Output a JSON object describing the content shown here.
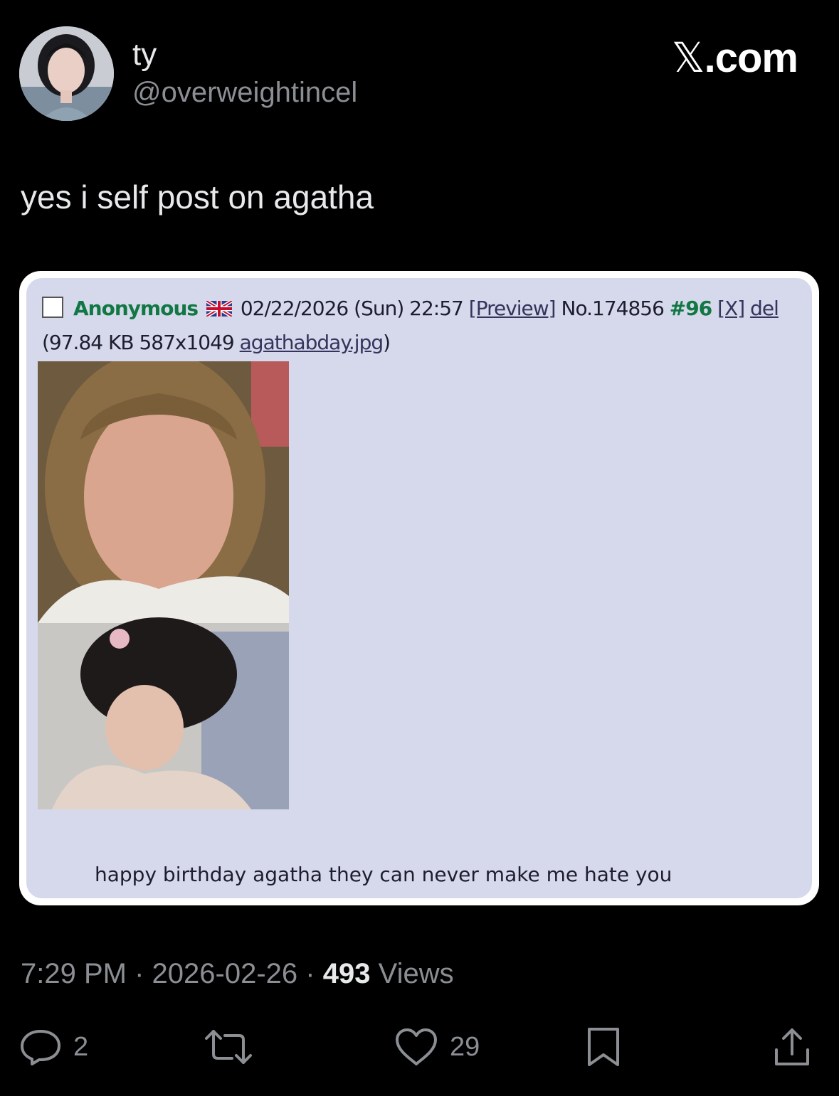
{
  "author": {
    "display_name": "ty",
    "handle": "@overweightincel",
    "avatar_icon": "profile-photo"
  },
  "brand": {
    "x_glyph": "𝕏",
    "suffix": ".com"
  },
  "tweet": {
    "text": "yes i self post on agatha"
  },
  "embedded_post": {
    "name": "Anonymous",
    "flag_icon": "uk-flag-icon",
    "datetime": "02/22/2026 (Sun) 22:57",
    "preview_label": "[Preview]",
    "post_number": "No.174856",
    "reply_ref": "#96",
    "delete_x_label": "[X]",
    "del_label": "del",
    "file_meta": "(97.84 KB 587x1049",
    "file_name": "agathabday.jpg",
    "file_close": ")",
    "comment": "happy birthday agatha they can never make me hate you"
  },
  "meta": {
    "time": "7:29 PM",
    "date": "2026-02-26",
    "views_count": "493",
    "views_label": "Views",
    "separator": "·"
  },
  "actions": {
    "reply_count": "2",
    "like_count": "29",
    "icons": [
      "reply-icon",
      "retweet-icon",
      "like-icon",
      "bookmark-icon",
      "share-icon"
    ]
  },
  "colors": {
    "background": "#000000",
    "secondary_text": "#8b8f94",
    "post_bg": "#d6d9ec",
    "anon_name": "#117743",
    "link": "#34345c"
  }
}
